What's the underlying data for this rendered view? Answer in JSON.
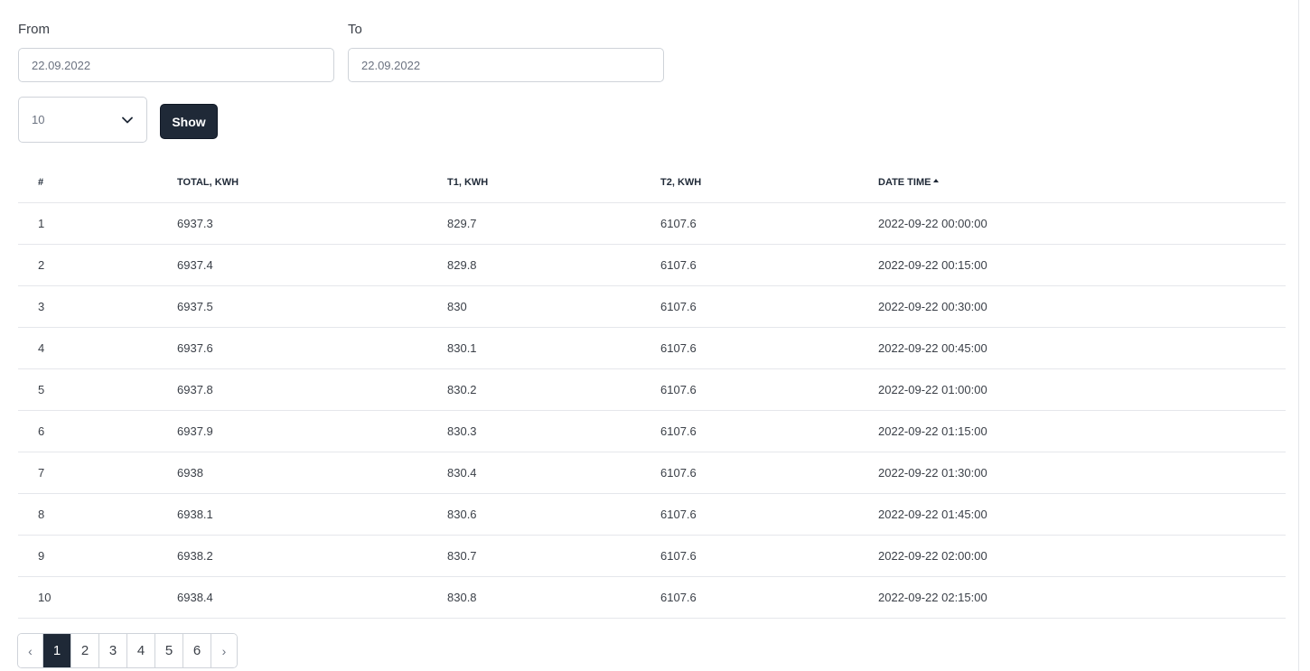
{
  "filters": {
    "from_label": "From",
    "from_value": "22.09.2022",
    "to_label": "To",
    "to_value": "22.09.2022",
    "page_size": "10",
    "show_label": "Show"
  },
  "table": {
    "headers": [
      "#",
      "TOTAL, KWH",
      "T1, KWH",
      "T2, KWH",
      "DATE TIME"
    ],
    "sorted_column": "DATE TIME",
    "rows": [
      [
        "1",
        "6937.3",
        "829.7",
        "6107.6",
        "2022-09-22 00:00:00"
      ],
      [
        "2",
        "6937.4",
        "829.8",
        "6107.6",
        "2022-09-22 00:15:00"
      ],
      [
        "3",
        "6937.5",
        "830",
        "6107.6",
        "2022-09-22 00:30:00"
      ],
      [
        "4",
        "6937.6",
        "830.1",
        "6107.6",
        "2022-09-22 00:45:00"
      ],
      [
        "5",
        "6937.8",
        "830.2",
        "6107.6",
        "2022-09-22 01:00:00"
      ],
      [
        "6",
        "6937.9",
        "830.3",
        "6107.6",
        "2022-09-22 01:15:00"
      ],
      [
        "7",
        "6938",
        "830.4",
        "6107.6",
        "2022-09-22 01:30:00"
      ],
      [
        "8",
        "6938.1",
        "830.6",
        "6107.6",
        "2022-09-22 01:45:00"
      ],
      [
        "9",
        "6938.2",
        "830.7",
        "6107.6",
        "2022-09-22 02:00:00"
      ],
      [
        "10",
        "6938.4",
        "830.8",
        "6107.6",
        "2022-09-22 02:15:00"
      ]
    ]
  },
  "pagination": {
    "prev": "‹",
    "next": "›",
    "pages": [
      "1",
      "2",
      "3",
      "4",
      "5",
      "6"
    ],
    "active": "1"
  },
  "colors": {
    "primary": "#1f2937",
    "border": "#cfd3d9",
    "row_divider": "#e5e7eb"
  }
}
